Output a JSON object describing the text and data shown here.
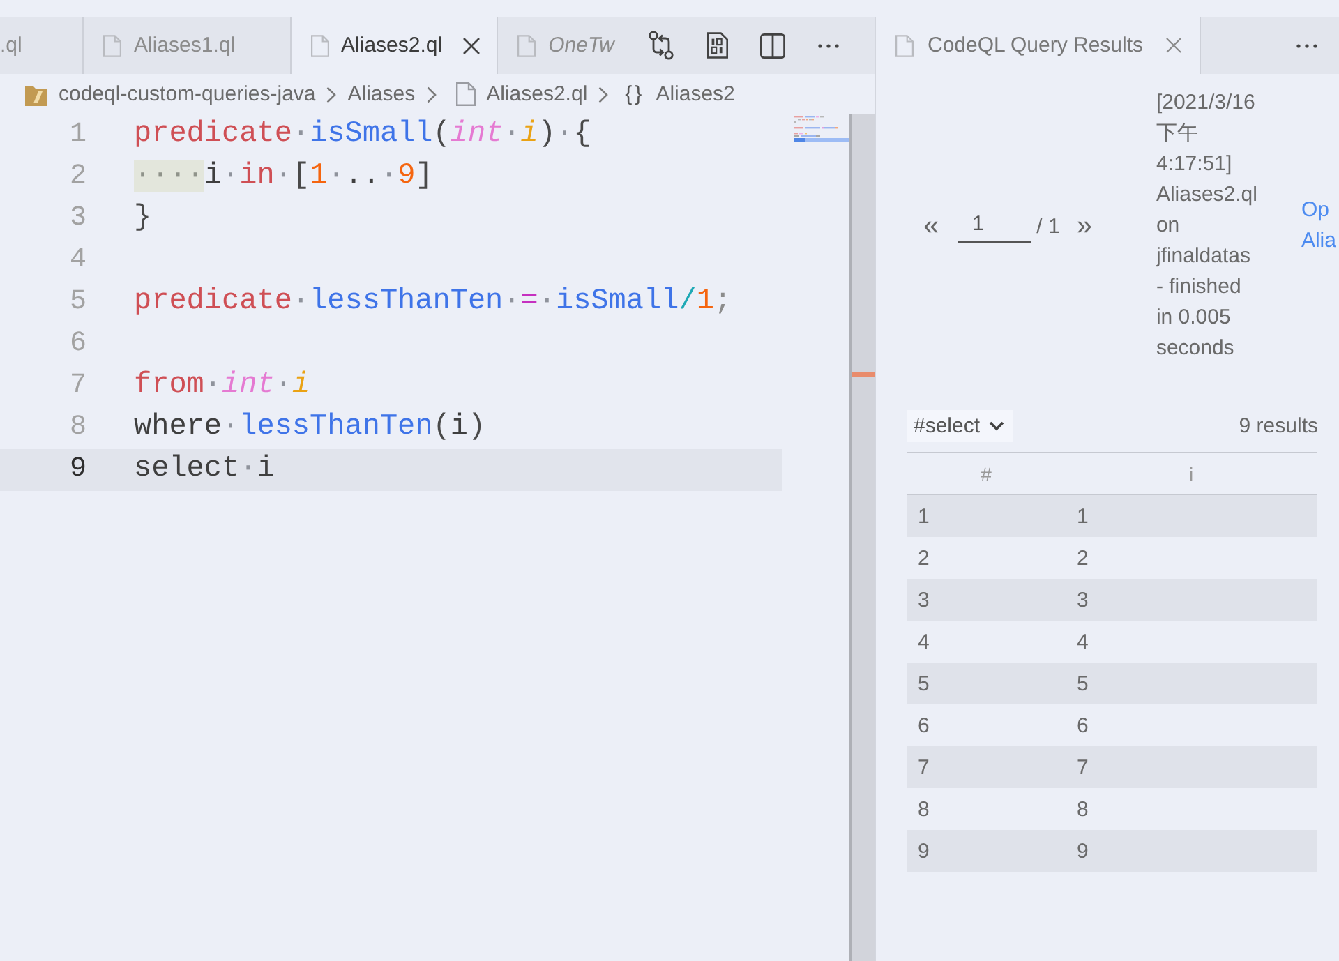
{
  "editor": {
    "tabs": [
      {
        "label": ".ql",
        "selected": false,
        "preview": false,
        "has_icon": false
      },
      {
        "label": "Aliases1.ql",
        "selected": false,
        "preview": false,
        "has_icon": true
      },
      {
        "label": "Aliases2.ql",
        "selected": true,
        "preview": false,
        "has_icon": true
      },
      {
        "label": "OneTw",
        "selected": false,
        "preview": true,
        "has_icon": true
      }
    ],
    "actions": [
      {
        "kind": "compare"
      },
      {
        "kind": "binary"
      },
      {
        "kind": "split"
      },
      {
        "kind": "more"
      }
    ],
    "breadcrumbs": [
      {
        "kind": "project",
        "label": "codeql-custom-queries-java"
      },
      {
        "kind": "folder",
        "label": "Aliases"
      },
      {
        "kind": "file",
        "label": "Aliases2.ql"
      },
      {
        "kind": "symbol",
        "glyph": "{}",
        "label": "Aliases2"
      }
    ],
    "lines": [
      {
        "number": "1",
        "current": false,
        "tokens": [
          {
            "kind": "keyword",
            "text": "predicate"
          },
          {
            "kind": "ws",
            "text": "·"
          },
          {
            "kind": "function",
            "text": "isSmall"
          },
          {
            "kind": "punct",
            "text": "("
          },
          {
            "kind": "type",
            "text": "int"
          },
          {
            "kind": "ws",
            "text": "·"
          },
          {
            "kind": "variable",
            "text": "i"
          },
          {
            "kind": "punct",
            "text": ")"
          },
          {
            "kind": "ws",
            "text": "·"
          },
          {
            "kind": "punct",
            "text": "{"
          }
        ]
      },
      {
        "number": "2",
        "current": false,
        "tokens": [
          {
            "kind": "indent",
            "text": "····"
          },
          {
            "kind": "plain",
            "text": "i"
          },
          {
            "kind": "ws",
            "text": "·"
          },
          {
            "kind": "keyword",
            "text": "in"
          },
          {
            "kind": "ws",
            "text": "·"
          },
          {
            "kind": "punct",
            "text": "["
          },
          {
            "kind": "number",
            "text": "1"
          },
          {
            "kind": "ws",
            "text": "·"
          },
          {
            "kind": "plain",
            "text": ".."
          },
          {
            "kind": "ws",
            "text": "·"
          },
          {
            "kind": "number",
            "text": "9"
          },
          {
            "kind": "punct",
            "text": "]"
          }
        ]
      },
      {
        "number": "3",
        "current": false,
        "tokens": [
          {
            "kind": "punct",
            "text": "}"
          }
        ]
      },
      {
        "number": "4",
        "current": false
      },
      {
        "number": "5",
        "current": false,
        "tokens": [
          {
            "kind": "keyword",
            "text": "predicate"
          },
          {
            "kind": "ws",
            "text": "·"
          },
          {
            "kind": "function",
            "text": "lessThanTen"
          },
          {
            "kind": "ws",
            "text": "·"
          },
          {
            "kind": "operator",
            "text": "="
          },
          {
            "kind": "ws",
            "text": "·"
          },
          {
            "kind": "function",
            "text": "isSmall"
          },
          {
            "kind": "arity",
            "text": "/"
          },
          {
            "kind": "number",
            "text": "1"
          },
          {
            "kind": "semi",
            "text": ";"
          }
        ]
      },
      {
        "number": "6",
        "current": false
      },
      {
        "number": "7",
        "current": false,
        "tokens": [
          {
            "kind": "keyword",
            "text": "from"
          },
          {
            "kind": "ws",
            "text": "·"
          },
          {
            "kind": "type",
            "text": "int"
          },
          {
            "kind": "ws",
            "text": "·"
          },
          {
            "kind": "variable",
            "text": "i"
          }
        ]
      },
      {
        "number": "8",
        "current": false,
        "tokens": [
          {
            "kind": "plain",
            "text": "where"
          },
          {
            "kind": "ws",
            "text": "·"
          },
          {
            "kind": "function",
            "text": "lessThanTen"
          },
          {
            "kind": "punct",
            "text": "("
          },
          {
            "kind": "plain",
            "text": "i"
          },
          {
            "kind": "punct",
            "text": ")"
          }
        ]
      },
      {
        "number": "9",
        "current": true,
        "tokens": [
          {
            "kind": "plain",
            "text": "select"
          },
          {
            "kind": "ws",
            "text": "·"
          },
          {
            "kind": "plain",
            "text": "i"
          }
        ]
      }
    ]
  },
  "results": {
    "tabs": [
      {
        "label": "CodeQL Query Results",
        "selected": true
      }
    ],
    "pager": {
      "prev": "«",
      "page": "1",
      "total": "/ 1",
      "next": "»"
    },
    "info": "[2021/3/16 下午 4:17:51] Aliases2.ql on jfinaldatas - finished in 0.005 seconds",
    "open_link": "Op Alia",
    "result_set": "#select",
    "count": "9 results",
    "table": {
      "columns": [
        "#",
        "i"
      ],
      "rows": [
        [
          "1",
          "1"
        ],
        [
          "2",
          "2"
        ],
        [
          "3",
          "3"
        ],
        [
          "4",
          "4"
        ],
        [
          "5",
          "5"
        ],
        [
          "6",
          "6"
        ],
        [
          "7",
          "7"
        ],
        [
          "8",
          "8"
        ],
        [
          "9",
          "9"
        ]
      ]
    }
  }
}
